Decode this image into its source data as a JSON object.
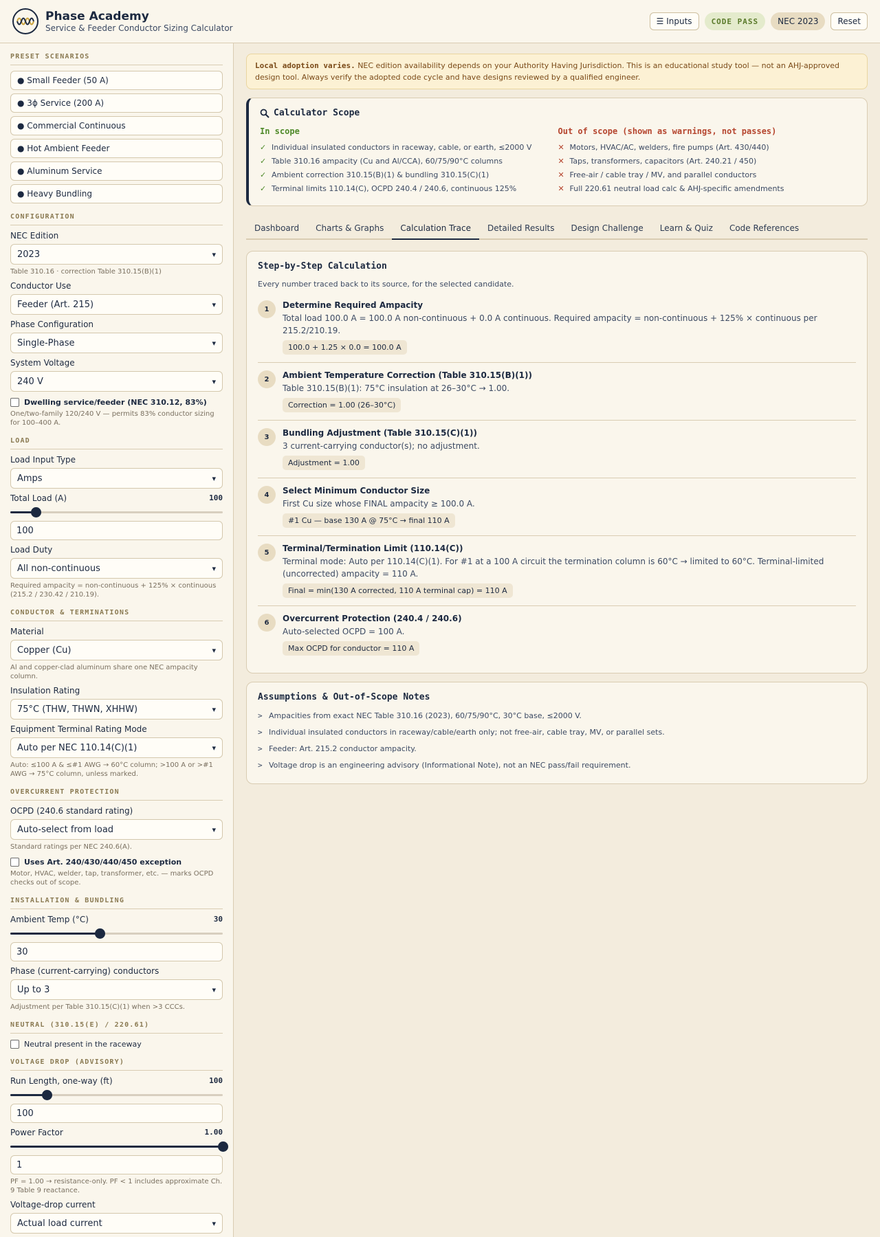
{
  "brand": {
    "title": "Phase Academy",
    "subtitle": "Service & Feeder Conductor Sizing Calculator"
  },
  "header": {
    "inputs_label": "☰ Inputs",
    "status": "CODE PASS",
    "edition": "NEC 2023",
    "reset_label": "Reset"
  },
  "presets": {
    "title": "PRESET SCENARIOS",
    "items": [
      "● Small Feeder (50 A)",
      "● 3ϕ Service (200 A)",
      "● Commercial Continuous",
      "● Hot Ambient Feeder",
      "● Aluminum Service",
      "● Heavy Bundling"
    ]
  },
  "config": {
    "title": "CONFIGURATION",
    "nec_label": "NEC Edition",
    "nec_value": "2023",
    "nec_help": "Table 310.16 · correction Table 310.15(B)(1)",
    "use_label": "Conductor Use",
    "use_value": "Feeder (Art. 215)",
    "phase_label": "Phase Configuration",
    "phase_value": "Single-Phase",
    "voltage_label": "System Voltage",
    "voltage_value": "240 V",
    "dwelling_label": "Dwelling service/feeder (NEC 310.12, 83%)",
    "dwelling_help": "One/two-family 120/240 V — permits 83% conductor sizing for 100–400 A."
  },
  "load": {
    "title": "LOAD",
    "type_label": "Load Input Type",
    "type_value": "Amps",
    "total_label": "Total Load (A)",
    "total_value": "100",
    "total_fraction": 0.12,
    "total_input": "100",
    "duty_label": "Load Duty",
    "duty_value": "All non-continuous",
    "duty_help": "Required ampacity = non-continuous + 125% × continuous (215.2 / 230.42 / 210.19)."
  },
  "conductor": {
    "title": "CONDUCTOR & TERMINATIONS",
    "material_label": "Material",
    "material_value": "Copper (Cu)",
    "material_help": "Al and copper-clad aluminum share one NEC ampacity column.",
    "insulation_label": "Insulation Rating",
    "insulation_value": "75°C (THW, THWN, XHHW)",
    "terminal_label": "Equipment Terminal Rating Mode",
    "terminal_value": "Auto per NEC 110.14(C)(1)",
    "terminal_help": "Auto: ≤100 A & ≤#1 AWG → 60°C column; >100 A or >#1 AWG → 75°C column, unless marked."
  },
  "ocp": {
    "title": "OVERCURRENT PROTECTION",
    "ocpd_label": "OCPD (240.6 standard rating)",
    "ocpd_value": "Auto-select from load",
    "ocpd_help": "Standard ratings per NEC 240.6(A).",
    "exception_label": "Uses Art. 240/430/440/450 exception",
    "exception_help": "Motor, HVAC, welder, tap, transformer, etc. — marks OCPD checks out of scope."
  },
  "install": {
    "title": "INSTALLATION & BUNDLING",
    "ambient_label": "Ambient Temp (°C)",
    "ambient_value": "30",
    "ambient_fraction": 0.42,
    "ambient_input": "30",
    "ccc_label": "Phase (current-carrying) conductors",
    "ccc_value": "Up to 3",
    "ccc_help": "Adjustment per Table 310.15(C)(1) when >3 CCCs."
  },
  "neutral": {
    "title": "NEUTRAL (310.15(E) / 220.61)",
    "present_label": "Neutral present in the raceway"
  },
  "vdrop": {
    "title": "VOLTAGE DROP (ADVISORY)",
    "run_label": "Run Length, one-way (ft)",
    "run_value": "100",
    "run_fraction": 0.17,
    "run_input": "100",
    "pf_label": "Power Factor",
    "pf_value": "1.00",
    "pf_fraction": 1.0,
    "pf_input": "1",
    "pf_help": "PF = 1.00 → resistance-only. PF < 1 includes approximate Ch. 9 Table 9 reactance.",
    "current_label": "Voltage-drop current",
    "current_value": "Actual load current"
  },
  "warning": {
    "strong": "Local adoption varies.",
    "text": " NEC edition availability depends on your Authority Having Jurisdiction. This is an educational study tool — not an AHJ-approved design tool. Always verify the adopted code cycle and have designs reviewed by a qualified engineer."
  },
  "scope": {
    "title": "Calculator Scope",
    "in_title": "In scope",
    "out_title": "Out of scope (shown as warnings, not passes)",
    "in_items": [
      "Individual insulated conductors in raceway, cable, or earth, ≤2000 V",
      "Table 310.16 ampacity (Cu and Al/CCA), 60/75/90°C columns",
      "Ambient correction 310.15(B)(1) & bundling 310.15(C)(1)",
      "Terminal limits 110.14(C), OCPD 240.4 / 240.6, continuous 125%"
    ],
    "out_items": [
      "Motors, HVAC/AC, welders, fire pumps (Art. 430/440)",
      "Taps, transformers, capacitors (Art. 240.21 / 450)",
      "Free-air / cable tray / MV, and parallel conductors",
      "Full 220.61 neutral load calc & AHJ-specific amendments"
    ]
  },
  "tabs": [
    "Dashboard",
    "Charts & Graphs",
    "Calculation Trace",
    "Detailed Results",
    "Design Challenge",
    "Learn & Quiz",
    "Code References"
  ],
  "trace": {
    "title": "Step-by-Step Calculation",
    "subtitle": "Every number traced back to its source, for the selected candidate.",
    "steps": [
      {
        "n": "1",
        "title": "Determine Required Ampacity",
        "desc": "Total load 100.0 A = 100.0 A non-continuous + 0.0 A continuous. Required ampacity = non-continuous + 125% × continuous per 215.2/210.19.",
        "formula": "100.0 + 1.25 × 0.0 = 100.0 A"
      },
      {
        "n": "2",
        "title": "Ambient Temperature Correction (Table 310.15(B)(1))",
        "desc": "Table 310.15(B)(1): 75°C insulation at 26–30°C → 1.00.",
        "formula": "Correction = 1.00 (26–30°C)"
      },
      {
        "n": "3",
        "title": "Bundling Adjustment (Table 310.15(C)(1))",
        "desc": "3 current-carrying conductor(s); no adjustment.",
        "formula": "Adjustment = 1.00"
      },
      {
        "n": "4",
        "title": "Select Minimum Conductor Size",
        "desc": "First Cu size whose FINAL ampacity ≥ 100.0 A.",
        "formula": "#1 Cu — base 130 A @ 75°C → final 110 A"
      },
      {
        "n": "5",
        "title": "Terminal/Termination Limit (110.14(C))",
        "desc": "Terminal mode: Auto per 110.14(C)(1). For #1 at a 100 A circuit the termination column is 60°C → limited to 60°C. Terminal-limited (uncorrected) ampacity = 110 A.",
        "formula": "Final = min(130 A corrected, 110 A terminal cap) = 110 A"
      },
      {
        "n": "6",
        "title": "Overcurrent Protection (240.4 / 240.6)",
        "desc": "Auto-selected OCPD = 100 A.",
        "formula": "Max OCPD for conductor = 110 A"
      }
    ]
  },
  "assumptions": {
    "title": "Assumptions & Out-of-Scope Notes",
    "items": [
      "Ampacities from exact NEC Table 310.16 (2023), 60/75/90°C, 30°C base, ≤2000 V.",
      "Individual insulated conductors in raceway/cable/earth only; not free-air, cable tray, MV, or parallel sets.",
      "Feeder: Art. 215.2 conductor ampacity.",
      "Voltage drop is an engineering advisory (Informational Note), not an NEC pass/fail requirement."
    ]
  }
}
